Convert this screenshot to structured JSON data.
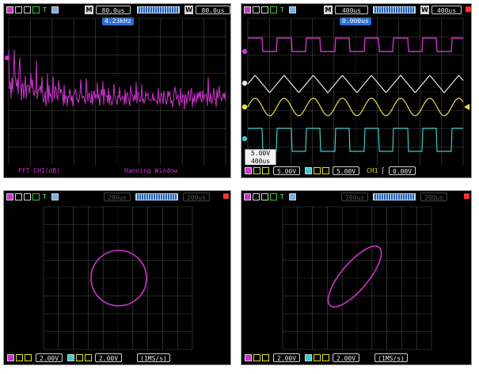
{
  "colors": {
    "ch1": "#cc33cc",
    "ch2": "#e8e8e8",
    "ch3": "#e6e050",
    "ch4": "#40c8c8",
    "grid": "#4a4a4a",
    "freq_badge": "#2a6fd6"
  },
  "panels": [
    {
      "id": "fft",
      "mode": "M",
      "left_time": "80.0us",
      "right_mode": "W",
      "right_time": "80.0us",
      "badge": "4.23kHz",
      "bottom_left": "FFT CH1(dB)",
      "bottom_right": "Hanning Window",
      "icons": [
        "probe-icon",
        "edge-icon",
        "pulse-icon",
        "T",
        "save-icon"
      ]
    },
    {
      "id": "multichannel",
      "mode": "M",
      "left_time": "400us",
      "right_mode": "W",
      "right_time": "400us",
      "badge": "0.000us",
      "readout_voltage": "5.00V",
      "readout_time": "400us",
      "ch_volts": [
        "5.00V",
        "5.00V"
      ],
      "trigger_channel": "CH1",
      "trigger_level": "0.00V",
      "channel_markers": [
        "1",
        "2",
        "3",
        "4"
      ]
    },
    {
      "id": "xy-circle",
      "left_time": "200us",
      "right_time": "200us",
      "volts": [
        "2.00V",
        "2.00V"
      ],
      "sample_rate": "(1MS/s)"
    },
    {
      "id": "xy-ellipse",
      "left_time": "200us",
      "right_time": "200us",
      "volts": [
        "2.00V",
        "2.00V"
      ],
      "sample_rate": "(1MS/s)"
    }
  ]
}
